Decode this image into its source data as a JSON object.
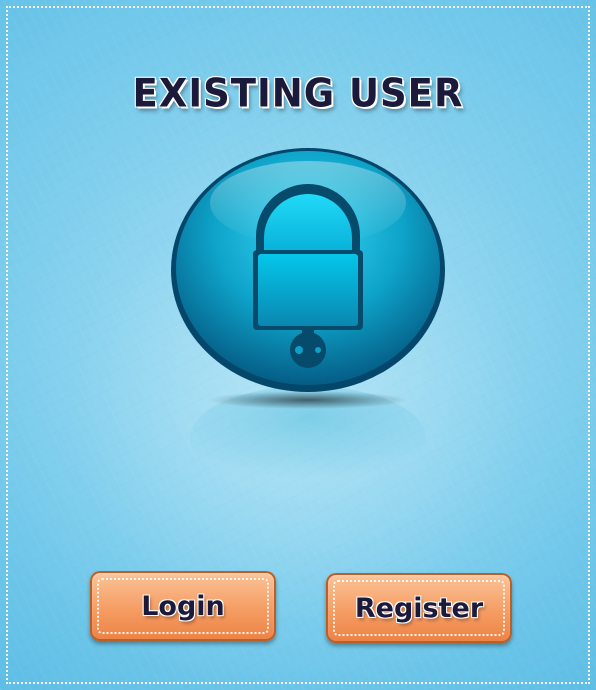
{
  "page": {
    "title": "EXISTING USER"
  },
  "icon": {
    "name": "padlock-icon"
  },
  "buttons": {
    "login_label": "Login",
    "register_label": "Register"
  },
  "colors": {
    "background": "#6fc7ea",
    "orb": "#0fa6c9",
    "button": "#f59d63",
    "text": "#1b1a3a"
  }
}
